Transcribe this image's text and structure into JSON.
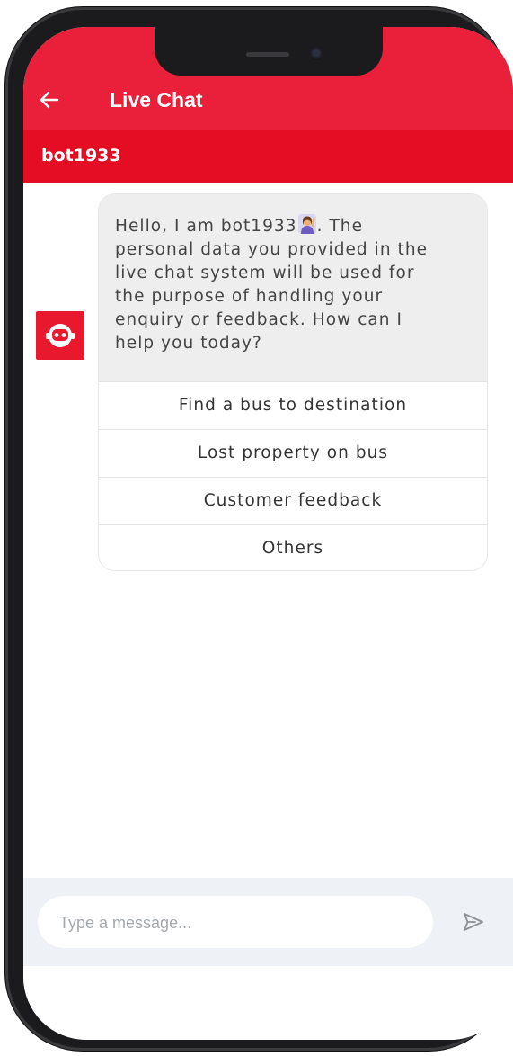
{
  "header": {
    "title": "Live Chat",
    "back_icon": "arrow-left-icon"
  },
  "chat": {
    "bot_name": "bot1933",
    "avatar_icon": "robot-icon",
    "message_lines": [
      "Hello, I am bot1933",
      ". The",
      "personal data you provided in the",
      "live chat system will be used for",
      "the purpose of handling your",
      "enquiry or feedback. How can I",
      "help you today?"
    ],
    "emoji_icon": "person-raising-hand-icon",
    "options": [
      "Find a bus to destination",
      "Lost property on bus",
      "Customer feedback",
      "Others"
    ]
  },
  "composer": {
    "placeholder": "Type a message...",
    "send_icon": "send-icon"
  },
  "colors": {
    "header_red": "#ea1f3a",
    "botbar_red": "#e50d24",
    "bubble_bg": "#eeeeee",
    "composer_bg": "#eef2f6"
  }
}
